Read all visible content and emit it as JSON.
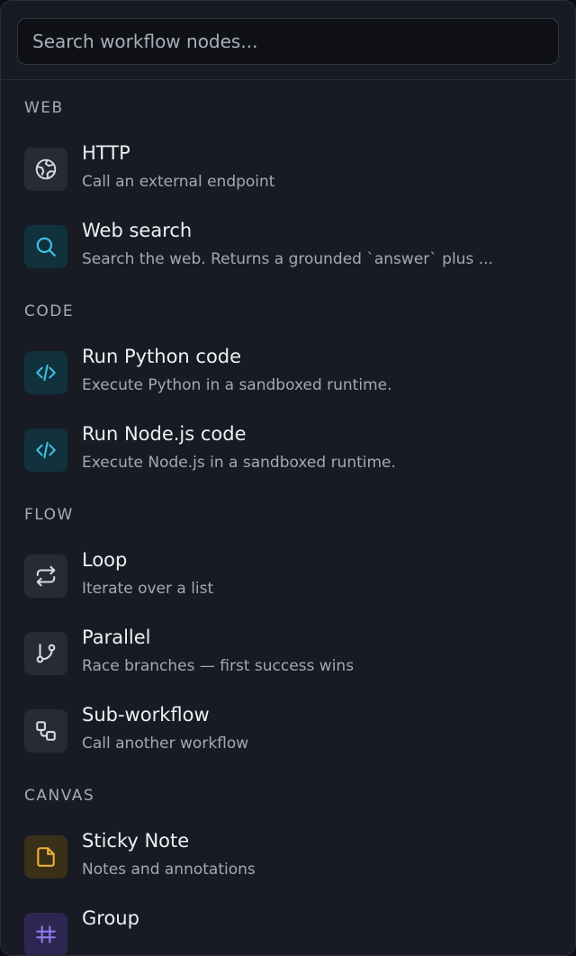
{
  "search": {
    "placeholder": "Search workflow nodes..."
  },
  "colors": {
    "panel_bg": "#181b23",
    "neutral_icon_bg": "#272b35",
    "code_icon_bg": "#11323d",
    "code_icon_fg": "#3fc0e6",
    "sticky_icon_bg": "#3a2f17",
    "sticky_icon_fg": "#f0b43a",
    "group_icon_bg": "#2e2650",
    "group_icon_fg": "#8f7cf0"
  },
  "sections": [
    {
      "title": "WEB",
      "items": [
        {
          "title": "HTTP",
          "description": "Call an external endpoint",
          "icon": "globe-icon"
        },
        {
          "title": "Web search",
          "description": "Search the web. Returns a grounded `answer` plus ...",
          "icon": "search-icon"
        }
      ]
    },
    {
      "title": "CODE",
      "items": [
        {
          "title": "Run Python code",
          "description": "Execute Python in a sandboxed runtime.",
          "icon": "code-icon"
        },
        {
          "title": "Run Node.js code",
          "description": "Execute Node.js in a sandboxed runtime.",
          "icon": "code-icon"
        }
      ]
    },
    {
      "title": "FLOW",
      "items": [
        {
          "title": "Loop",
          "description": "Iterate over a list",
          "icon": "repeat-icon"
        },
        {
          "title": "Parallel",
          "description": "Race branches — first success wins",
          "icon": "git-branch-icon"
        },
        {
          "title": "Sub-workflow",
          "description": "Call another workflow",
          "icon": "sub-workflow-icon"
        }
      ]
    },
    {
      "title": "CANVAS",
      "items": [
        {
          "title": "Sticky Note",
          "description": "Notes and annotations",
          "icon": "sticky-note-icon"
        },
        {
          "title": "Group",
          "description": "",
          "icon": "group-icon"
        }
      ]
    }
  ]
}
